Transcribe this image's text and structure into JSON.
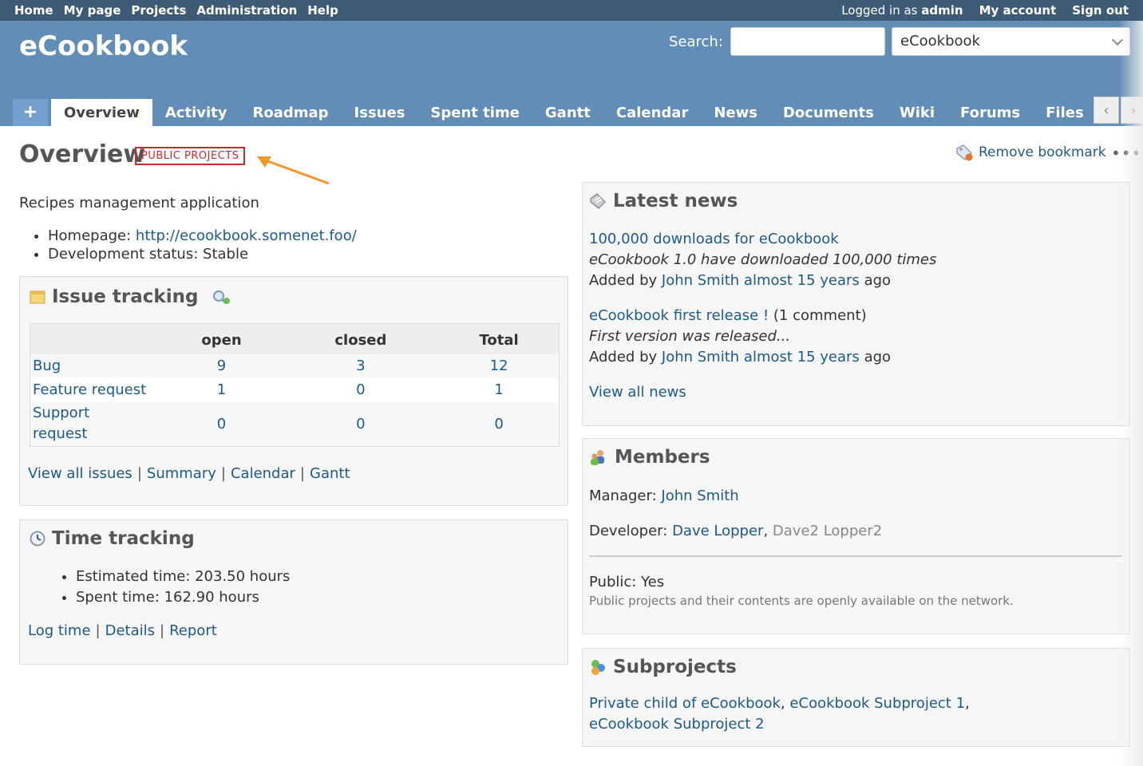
{
  "top_menu": {
    "items": [
      "Home",
      "My page",
      "Projects",
      "Administration",
      "Help"
    ],
    "logged_in_prefix": "Logged in as",
    "user": "admin",
    "my_account": "My account",
    "sign_out": "Sign out"
  },
  "header": {
    "project_title": "eCookbook",
    "search_label": "Search:",
    "search_value": "",
    "project_selected": "eCookbook"
  },
  "tabs": {
    "plus": "+",
    "items": [
      "Overview",
      "Activity",
      "Roadmap",
      "Issues",
      "Spent time",
      "Gantt",
      "Calendar",
      "News",
      "Documents",
      "Wiki",
      "Forums",
      "Files"
    ],
    "active": "Overview"
  },
  "page": {
    "title": "Overview",
    "badge": "PUBLIC PROJECTS",
    "bookmark": "Remove bookmark",
    "more": "•••",
    "description": "Recipes management application",
    "homepage_label": "Homepage:",
    "homepage_url": "http://ecookbook.somenet.foo/",
    "status_label": "Development status:",
    "status_value": "Stable"
  },
  "issue_tracking": {
    "title": "Issue tracking",
    "columns": [
      "",
      "open",
      "closed",
      "Total"
    ],
    "rows": [
      {
        "name": "Bug",
        "open": "9",
        "closed": "3",
        "total": "12"
      },
      {
        "name": "Feature request",
        "open": "1",
        "closed": "0",
        "total": "1"
      },
      {
        "name": "Support request",
        "open": "0",
        "closed": "0",
        "total": "0"
      }
    ],
    "links": [
      "View all issues",
      "Summary",
      "Calendar",
      "Gantt"
    ]
  },
  "time_tracking": {
    "title": "Time tracking",
    "estimated": "Estimated time: 203.50 hours",
    "spent": "Spent time: 162.90 hours",
    "links": [
      "Log time",
      "Details",
      "Report"
    ]
  },
  "latest_news": {
    "title": "Latest news",
    "items": [
      {
        "title": "100,000 downloads for eCookbook",
        "comments": "",
        "summary": "eCookbook 1.0 have downloaded 100,000 times",
        "added_by": "Added by",
        "author": "John Smith",
        "when": "almost 15 years",
        "ago": "ago"
      },
      {
        "title": "eCookbook first release !",
        "comments": "(1 comment)",
        "summary": "First version was released...",
        "added_by": "Added by",
        "author": "John Smith",
        "when": "almost 15 years",
        "ago": "ago"
      }
    ],
    "view_all": "View all news"
  },
  "members": {
    "title": "Members",
    "manager_label": "Manager:",
    "manager": "John Smith",
    "developer_label": "Developer:",
    "developer_1": "Dave Lopper",
    "developer_2": "Dave2 Lopper2",
    "public_label": "Public: Yes",
    "public_hint": "Public projects and their contents are openly available on the network."
  },
  "subprojects": {
    "title": "Subprojects",
    "items": [
      "Private child of eCookbook",
      "eCookbook Subproject 1",
      "eCookbook Subproject 2"
    ]
  },
  "colors": {
    "top_menu": "#3e5b76",
    "header": "#628db6",
    "link": "#1d5a8a",
    "badge": "#c62b2b",
    "arrow": "#f0992b"
  }
}
